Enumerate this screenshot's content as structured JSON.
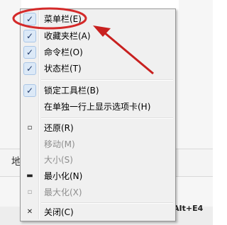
{
  "background": {
    "bar_text": "地",
    "bottom_text": "AIt+E4"
  },
  "menu": {
    "items": [
      {
        "label": "菜单栏(E)",
        "checked": true,
        "disabled": false
      },
      {
        "label": "收藏夹栏(A)",
        "checked": true,
        "disabled": false
      },
      {
        "label": "命令栏(O)",
        "checked": true,
        "disabled": false
      },
      {
        "label": "状态栏(T)",
        "checked": true,
        "disabled": false
      },
      {
        "label": "锁定工具栏(B)",
        "checked": true,
        "disabled": false
      },
      {
        "label": "在单独一行上显示选项卡(H)",
        "checked": false,
        "disabled": false
      },
      {
        "label": "还原(R)",
        "icon": "restore-icon",
        "disabled": false
      },
      {
        "label": "移动(M)",
        "disabled": true
      },
      {
        "label": "大小(S)",
        "disabled": true
      },
      {
        "label": "最小化(N)",
        "icon": "minimize-icon",
        "disabled": false
      },
      {
        "label": "最大化(X)",
        "icon": "maximize-icon",
        "disabled": true
      },
      {
        "label": "关闭(C)",
        "icon": "close-icon",
        "disabled": false
      }
    ],
    "check_glyph": "✓",
    "icons": {
      "restore": "▫",
      "minimize": "▬",
      "maximize": "▫",
      "close": "✕"
    }
  },
  "colors": {
    "highlight_ellipse": "#d42a2a",
    "arrow": "#c8201f",
    "check_bg": "#dce9f7"
  }
}
